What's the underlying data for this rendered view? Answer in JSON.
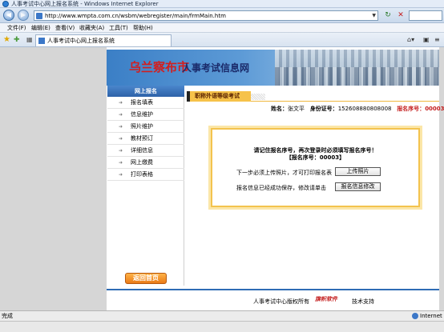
{
  "window": {
    "title": "人事考试中心网上报名系统 - Windows Internet Explorer"
  },
  "address": {
    "url": "http://www.wmpta.com.cn/wsbm/webregister/main/frmMain.htm"
  },
  "menu": [
    "文件(F)",
    "编辑(E)",
    "查看(V)",
    "收藏夹(A)",
    "工具(T)",
    "帮助(H)"
  ],
  "tab": {
    "label": "人事考试中心网上报名系统"
  },
  "banner": {
    "city": "乌兰察布市",
    "site": "人事考试信息网"
  },
  "sidebar": {
    "header": "网上报名",
    "items": [
      {
        "label": "报名填表"
      },
      {
        "label": "信息维护"
      },
      {
        "label": "照片维护"
      },
      {
        "label": "教材预订"
      },
      {
        "label": "详细信息"
      },
      {
        "label": "网上缴费"
      },
      {
        "label": "打印表格"
      }
    ],
    "back_label": "返回首页"
  },
  "section": {
    "title": "职称外语等级考试"
  },
  "info": {
    "name_key": "姓名：",
    "name_value": "张文平",
    "id_key": "身份证号：",
    "id_value": "152608880808008",
    "reg_key": "报名序号：",
    "reg_value": "00003"
  },
  "panel": {
    "line1": "请记住报名序号，再次登录时必须填写报名序号！",
    "line2": "【报名序号：00003】",
    "row1_text": "下一步必须上传照片，才可打印报名表",
    "row1_button": "上传照片",
    "row2_text": "报名信息已经成功保存，修改请单击",
    "row2_button": "报名信息修改"
  },
  "footer": {
    "left": "人事考试中心版权所有",
    "logo": "旗帜软件",
    "right": "技术支持"
  },
  "status": {
    "left": "完成",
    "zone": "Internet"
  }
}
